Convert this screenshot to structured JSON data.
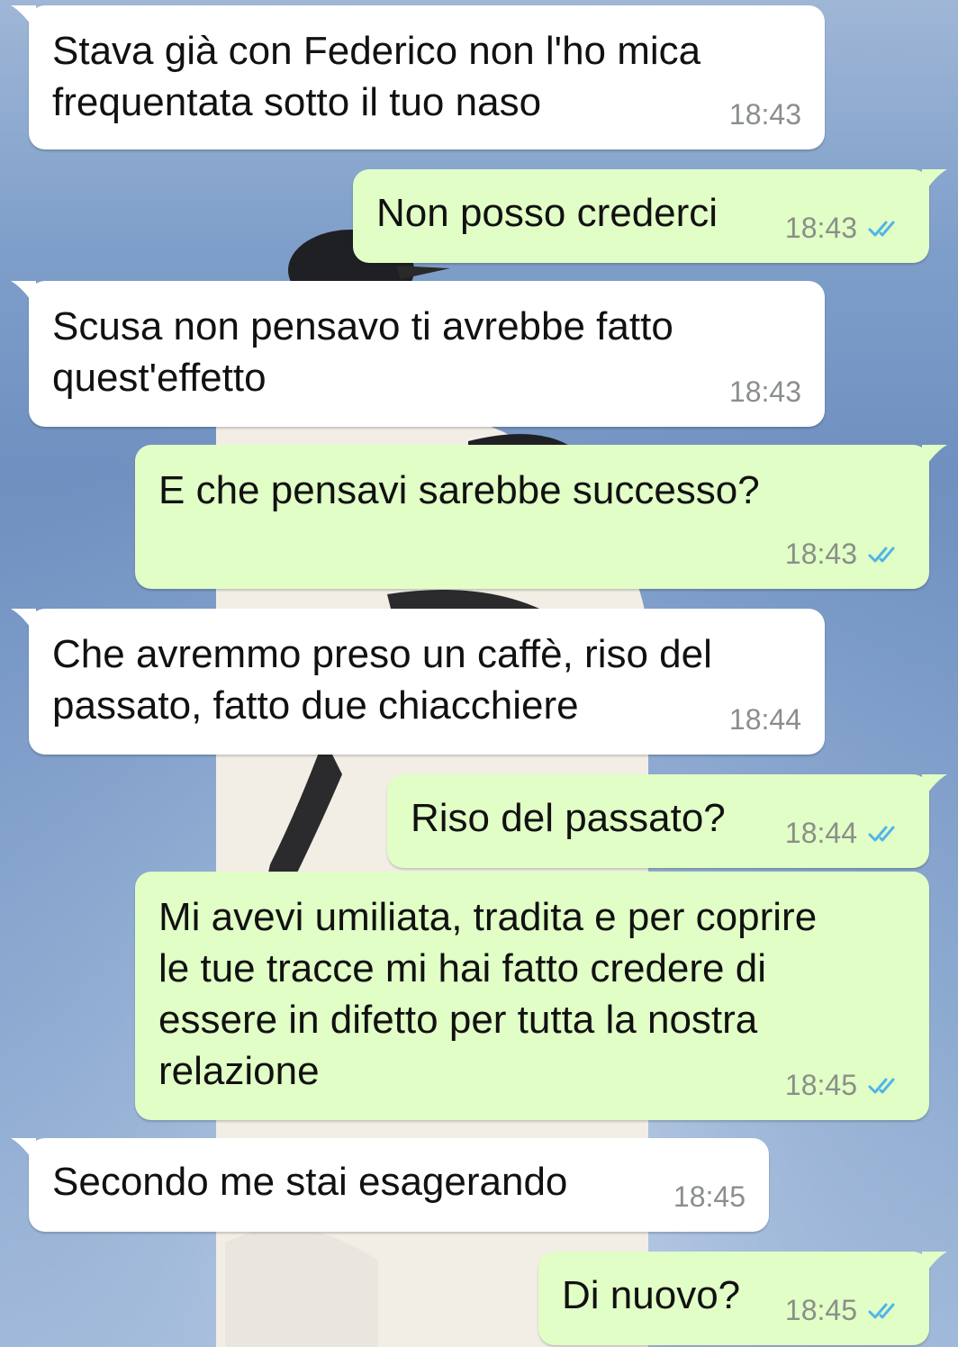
{
  "messages": [
    {
      "dir": "in",
      "text": "Stava già con Federico non l'ho mica\nfrequentata sotto il tuo naso",
      "time": "18:43"
    },
    {
      "dir": "out",
      "text": "Non posso crederci",
      "time": "18:43"
    },
    {
      "dir": "in",
      "text": "Scusa non pensavo ti avrebbe fatto\nquest'effetto",
      "time": "18:43"
    },
    {
      "dir": "out",
      "text": "E che pensavi sarebbe successo?",
      "time": "18:43"
    },
    {
      "dir": "in",
      "text": "Che avremmo preso un caffè, riso del\npassato, fatto due chiacchiere",
      "time": "18:44"
    },
    {
      "dir": "out",
      "text": "Riso del passato?",
      "time": "18:44"
    },
    {
      "dir": "out",
      "text": "Mi avevi umiliata, tradita e per coprire\nle tue tracce mi hai fatto credere di\nessere in difetto per tutta la nostra\nrelazione",
      "time": "18:45"
    },
    {
      "dir": "in",
      "text": "Secondo me stai esagerando",
      "time": "18:45"
    },
    {
      "dir": "out",
      "text": "Di nuovo?",
      "time": "18:45"
    }
  ],
  "colors": {
    "incoming": "#ffffff",
    "outgoing": "#e1fec6",
    "read_ticks": "#4fb5e8",
    "time": "#8a8f8a"
  },
  "icons": {
    "read_receipt": "double-check-icon"
  }
}
